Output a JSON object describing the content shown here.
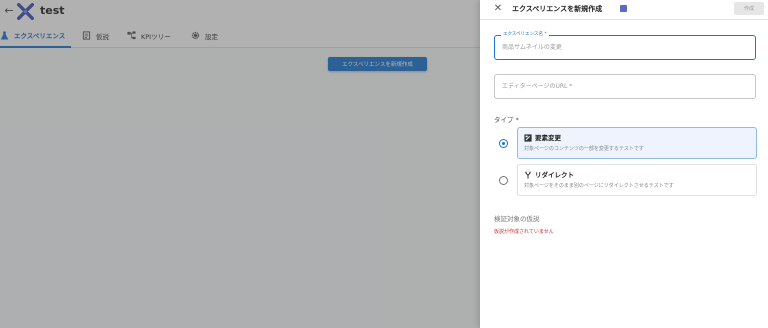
{
  "app": {
    "project_name": "test",
    "tabs": [
      {
        "label": "エクスペリエンス",
        "icon": "flask-icon",
        "active": true
      },
      {
        "label": "仮説",
        "icon": "document-icon",
        "active": false
      },
      {
        "label": "KPIツリー",
        "icon": "tree-icon",
        "active": false
      },
      {
        "label": "設定",
        "icon": "gear-icon",
        "active": false
      }
    ],
    "new_experience_button": "エクスペリエンスを新規作成",
    "colors": {
      "accent": "#1976d2",
      "logo": "#3f51b5",
      "error": "#d32f2f"
    }
  },
  "drawer": {
    "title": "エクスペリエンスを新規作成",
    "create_button": "作成",
    "name_field": {
      "label": "エクスペリエンス名 *",
      "placeholder": "商品サムネイルの変更",
      "value": ""
    },
    "url_field": {
      "placeholder": "エディターページのURL *",
      "value": ""
    },
    "type_label": "タイプ *",
    "type_options": [
      {
        "title": "要素変更",
        "description": "対象ページのコンテンツの一部を変更するテストです",
        "icon": "edit-element-icon",
        "selected": true
      },
      {
        "title": "リダイレクト",
        "description": "対象ページをそのまま別のページにリダイレクトさせるテストです",
        "icon": "redirect-icon",
        "selected": false
      }
    ],
    "hypothesis_label": "検証対象の仮説",
    "hypothesis_empty": "仮説が作成されていません"
  }
}
